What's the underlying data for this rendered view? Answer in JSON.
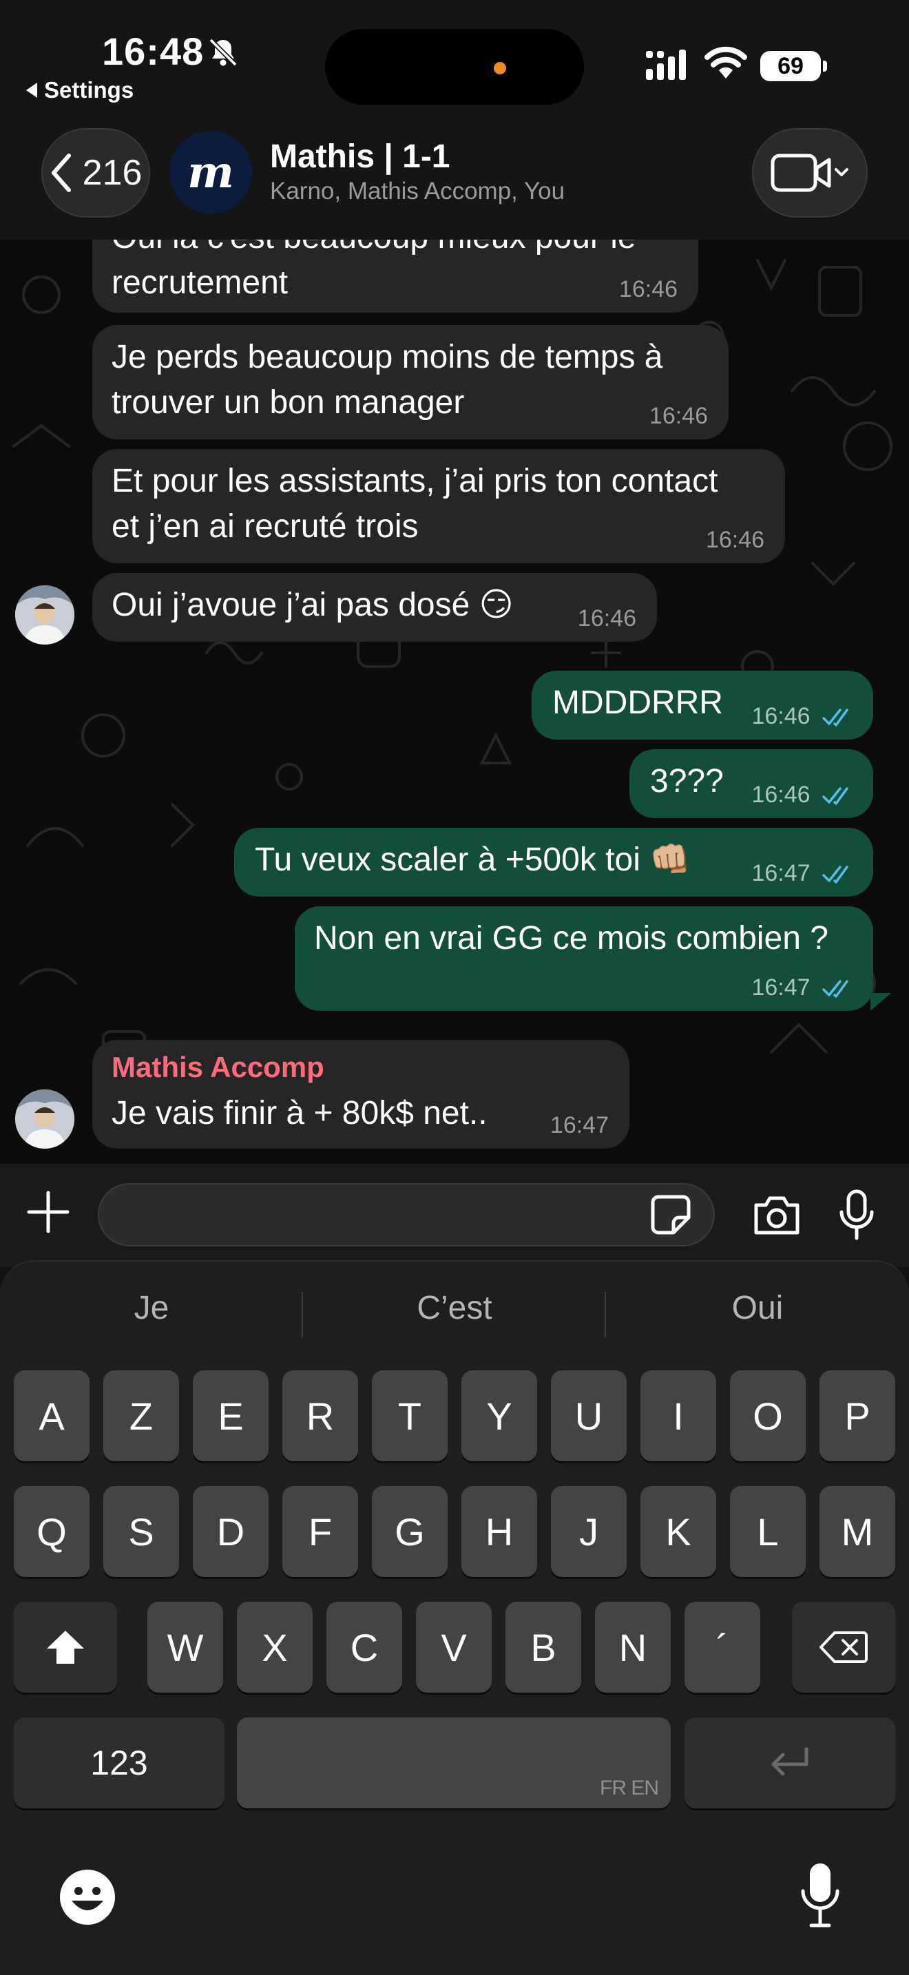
{
  "status_bar": {
    "time": "16:48",
    "back_app": "Settings",
    "battery": "69"
  },
  "header": {
    "back_count": "216",
    "avatar_letter": "m",
    "title": "Mathis | 1-1",
    "subtitle": "Karno, Mathis Accomp, You"
  },
  "messages": [
    {
      "text": "Oui là c'est beaucoup mieux pour le recrutement",
      "text_line1": "Oui là c'est beaucoup mieux pour le",
      "text_line2": "recrutement",
      "time": "16:46",
      "direction": "incoming"
    },
    {
      "text_line1": "Je perds beaucoup moins de temps à",
      "text_line2": "trouver un bon manager",
      "time": "16:46",
      "direction": "incoming"
    },
    {
      "text_line1": "Et pour les assistants, j’ai pris ton contact",
      "text_line2": "et j’en ai recruté trois",
      "time": "16:46",
      "direction": "incoming"
    },
    {
      "text": "Oui j’avoue j’ai pas dosé 😏",
      "time": "16:46",
      "direction": "incoming"
    },
    {
      "text": "MDDDRRR",
      "time": "16:46",
      "direction": "outgoing",
      "status": "read"
    },
    {
      "text": "3???",
      "time": "16:46",
      "direction": "outgoing",
      "status": "read"
    },
    {
      "text": "Tu veux scaler à +500k toi 👊🏼",
      "time": "16:47",
      "direction": "outgoing",
      "status": "read"
    },
    {
      "text": "Non en vrai GG ce mois combien ?",
      "time": "16:47",
      "direction": "outgoing",
      "status": "read"
    },
    {
      "sender": "Mathis Accomp",
      "text": "Je vais finir à + 80k$ net..",
      "time": "16:47",
      "direction": "incoming"
    }
  ],
  "colors": {
    "incoming_bubble": "#262626",
    "outgoing_bubble": "#134e3a",
    "sender_name": "#ff6b7d",
    "read_ticks": "#53bdeb"
  },
  "keyboard": {
    "suggestions": [
      "Je",
      "C’est",
      "Oui"
    ],
    "row1": [
      "A",
      "Z",
      "E",
      "R",
      "T",
      "Y",
      "U",
      "I",
      "O",
      "P"
    ],
    "row2": [
      "Q",
      "S",
      "D",
      "F",
      "G",
      "H",
      "J",
      "K",
      "L",
      "M"
    ],
    "row3": [
      "W",
      "X",
      "C",
      "V",
      "B",
      "N",
      "´"
    ],
    "numbers_key": "123",
    "space_languages": "FR EN",
    "icons": [
      "shift-icon",
      "backspace-icon",
      "return-icon",
      "emoji-icon",
      "dictation-mic-icon"
    ]
  }
}
